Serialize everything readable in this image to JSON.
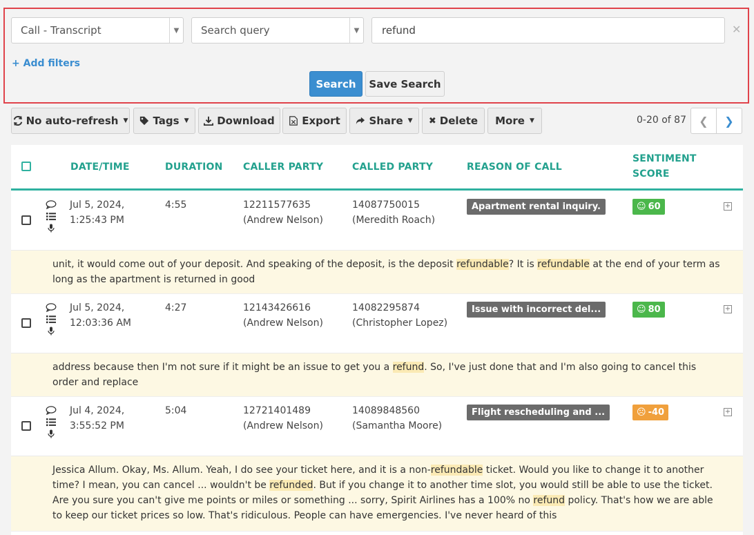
{
  "search": {
    "type_select": "Call - Transcript",
    "field_select": "Search query",
    "query_value": "refund",
    "add_filters": "Add filters",
    "search_button": "Search",
    "save_button": "Save Search"
  },
  "toolbar": {
    "auto_refresh": "No auto-refresh",
    "tags": "Tags",
    "download": "Download",
    "export": "Export",
    "share": "Share",
    "delete": "Delete",
    "more": "More",
    "pagination": "0-20 of 87"
  },
  "table": {
    "headers": {
      "datetime": "DATE/TIME",
      "duration": "DURATION",
      "caller": "CALLER PARTY",
      "called": "CALLED PARTY",
      "reason": "REASON OF CALL",
      "sentiment_1": "SENTIMENT",
      "sentiment_2": "SCORE"
    },
    "rows": [
      {
        "date": "Jul 5, 2024,",
        "time": "1:25:43 PM",
        "duration": "4:55",
        "caller_num": "12211577635",
        "caller_name": "(Andrew Nelson)",
        "called_num": "14087750015",
        "called_name": "(Meredith Roach)",
        "reason": "Apartment rental inquiry.",
        "sentiment": "60",
        "sentiment_level": "positive",
        "snippet": [
          {
            "t": "unit, it would come out of your deposit. And speaking of the deposit, is the deposit "
          },
          {
            "t": "refundable",
            "h": true
          },
          {
            "t": "? It is "
          },
          {
            "t": "refundable",
            "h": true
          },
          {
            "t": " at the end of your term as long as the apartment is returned in good"
          }
        ]
      },
      {
        "date": "Jul 5, 2024,",
        "time": "12:03:36 AM",
        "duration": "4:27",
        "caller_num": "12143426616",
        "caller_name": "(Andrew Nelson)",
        "called_num": "14082295874",
        "called_name": "(Christopher Lopez)",
        "reason": "Issue with incorrect del...",
        "sentiment": "80",
        "sentiment_level": "positive",
        "snippet": [
          {
            "t": "address because then I'm not sure if it might be an issue to get you a "
          },
          {
            "t": "refund",
            "h": true
          },
          {
            "t": ". So, I've just done that and I'm also going to cancel this order and replace"
          }
        ]
      },
      {
        "date": "Jul 4, 2024,",
        "time": "3:55:52 PM",
        "duration": "5:04",
        "caller_num": "12721401489",
        "caller_name": "(Andrew Nelson)",
        "called_num": "14089848560",
        "called_name": "(Samantha Moore)",
        "reason": "Flight rescheduling and ...",
        "sentiment": "-40",
        "sentiment_level": "negative",
        "snippet": [
          {
            "t": "Jessica Allum. Okay, Ms. Allum. Yeah, I do see your ticket here, and it is a non-"
          },
          {
            "t": "refundable",
            "h": true
          },
          {
            "t": " ticket. Would you like to change it to another time? I mean, you can cancel ... wouldn't be "
          },
          {
            "t": "refunded",
            "h": true
          },
          {
            "t": ". But if you change it to another time slot, you would still be able to use the ticket. Are you sure you can't give me points or miles or something ... sorry, Spirit Airlines has a 100% no "
          },
          {
            "t": "refund",
            "h": true
          },
          {
            "t": " policy. That's how we are able to keep our ticket prices so low. That's ridiculous. People can have emergencies. I've never heard of this"
          }
        ]
      }
    ]
  }
}
